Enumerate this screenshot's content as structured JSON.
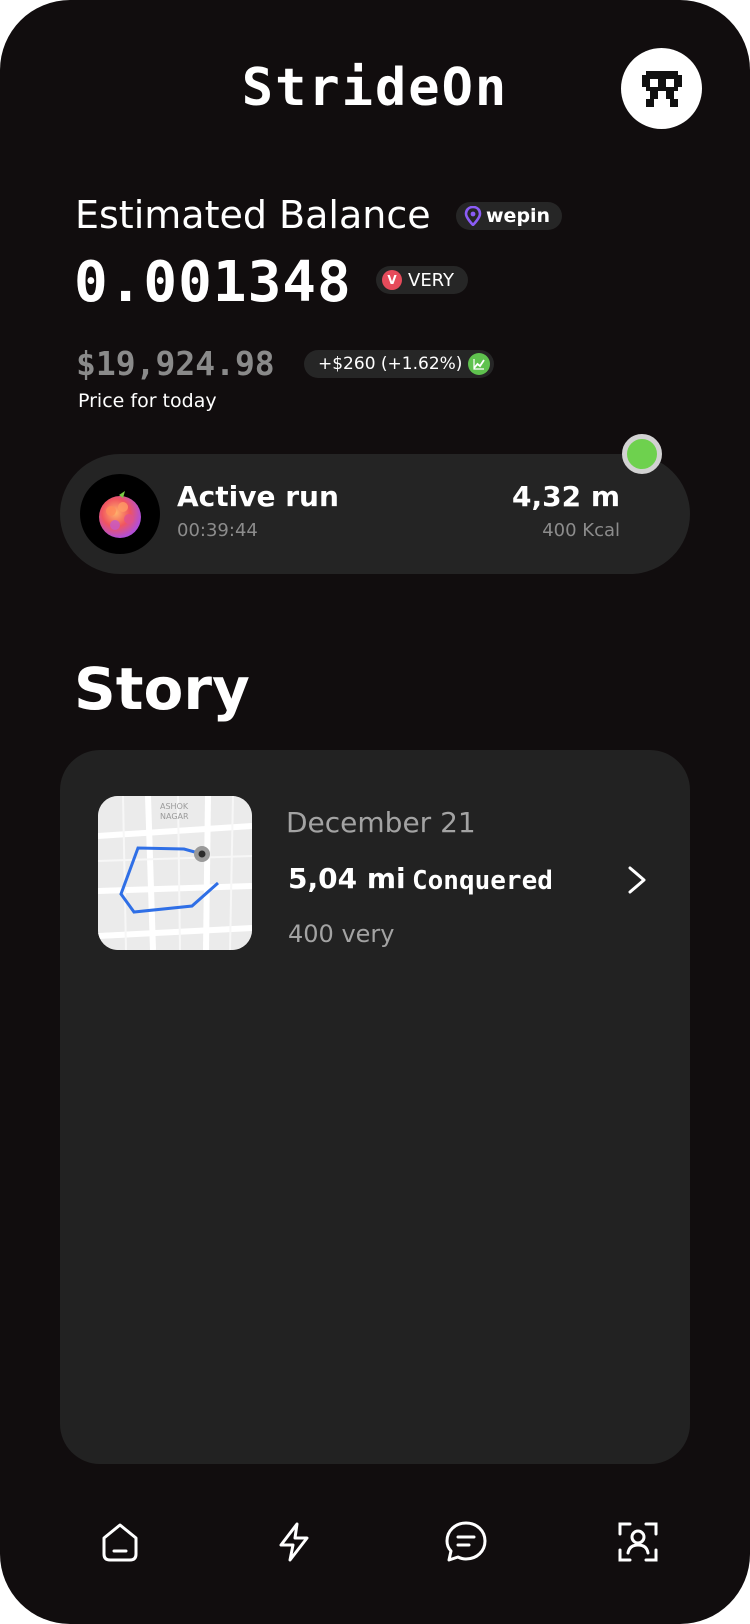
{
  "header": {
    "app_title": "StrideOn"
  },
  "balance": {
    "label": "Estimated Balance",
    "provider": "wepin",
    "value": "0.001348",
    "token": "VERY",
    "usd_value": "$19,924.98",
    "change": "+$260 (+1.62%)",
    "note": "Price for today"
  },
  "active_run": {
    "title": "Active run",
    "elapsed": "00:39:44",
    "distance": "4,32 m",
    "calories": "400 Kcal",
    "status_color": "#6ed14e"
  },
  "story": {
    "title": "Story",
    "items": [
      {
        "date": "December 21",
        "distance": "5,04 mi",
        "status": "Conquered",
        "reward": "400 very",
        "map_labels": [
          "ASHOK",
          "NAGAR"
        ]
      }
    ]
  },
  "nav": {
    "items": [
      {
        "icon": "home-icon"
      },
      {
        "icon": "lightning-icon"
      },
      {
        "icon": "chat-icon"
      },
      {
        "icon": "profile-scan-icon"
      }
    ]
  }
}
